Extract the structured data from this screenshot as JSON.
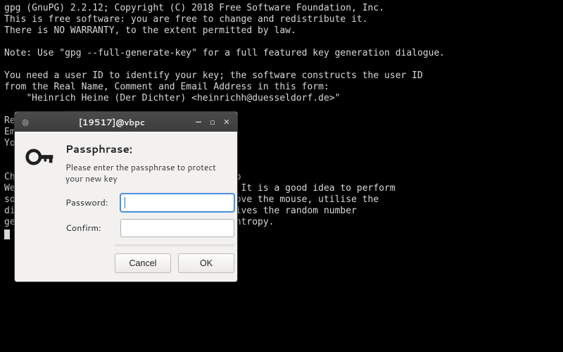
{
  "terminal": {
    "lines": [
      "gpg (GnuPG) 2.2.12; Copyright (C) 2018 Free Software Foundation, Inc.",
      "This is free software: you are free to change and redistribute it.",
      "There is NO WARRANTY, to the extent permitted by law.",
      "",
      "Note: Use \"gpg --full-generate-key\" for a full featured key generation dialogue.",
      "",
      "You need a user ID to identify your key; the software constructs the user ID",
      "from the Real Name, Comment and Email Address in this form:",
      "    \"Heinrich Heine (Der Dichter) <heinrichh@duesseldorf.de>\"",
      "",
      "Real name: ",
      "Email address: ",
      "You selected this USER-ID:",
      "    \"",
      "",
      "Change (N)ame, (E)mail, or (O)kay/(Q)uit? o",
      "We need to generate a lot of random bytes. It is a good idea to perform",
      "some other action (type on the keyboard, move the mouse, utilise the",
      "disks) during the prime generation; this gives the random number",
      "generator a better chance to gain enough entropy."
    ],
    "blurred_after_at": {
      "10": "██████",
      "11": "██████████████",
      "13": "████████████████████\""
    }
  },
  "dialog": {
    "title": "[19517]@vbpc",
    "icon_name": "key-icon",
    "heading": "Passphrase:",
    "description": "Please enter the passphrase to protect your new key",
    "password_label": "Password:",
    "confirm_label": "Confirm:",
    "password_value": "",
    "confirm_value": "",
    "cancel_label": "Cancel",
    "ok_label": "OK"
  }
}
